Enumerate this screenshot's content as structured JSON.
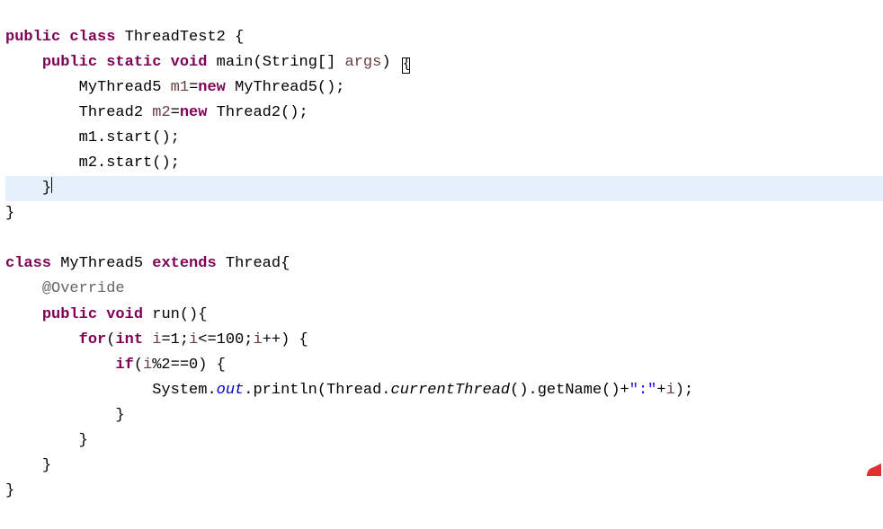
{
  "code": {
    "line1": {
      "public": "public",
      "class": "class",
      "classname": "ThreadTest2",
      "brace": "{"
    },
    "line2": {
      "public": "public",
      "static": "static",
      "void": "void",
      "method": "main",
      "paramtype": "String[]",
      "paramname": "args",
      "close": ")",
      "brace": "{"
    },
    "line3": {
      "type": "MyThread5",
      "varname": "m1",
      "eq": "=",
      "new": "new",
      "ctor": "MyThread5()",
      "semi": ";"
    },
    "line4": {
      "type": "Thread2",
      "varname": "m2",
      "eq": "=",
      "new": "new",
      "ctor": "Thread2()",
      "semi": ";"
    },
    "line5": {
      "text": "m1.start();"
    },
    "line6": {
      "text": "m2.start();"
    },
    "line7": {
      "brace": "}"
    },
    "line8": {
      "brace": "}"
    },
    "line9": {
      "blank": ""
    },
    "line10": {
      "class": "class",
      "classname": "MyThread5",
      "extends": "extends",
      "supername": "Thread",
      "brace": "{"
    },
    "line11": {
      "annotation": "@Override"
    },
    "line12": {
      "public": "public",
      "void": "void",
      "method": "run",
      "parens": "()",
      "brace": "{"
    },
    "line13": {
      "for": "for",
      "open": "(",
      "int": "int",
      "var": "i",
      "init": "=1;",
      "cond_var": "i",
      "cond": "<=100;",
      "inc_var": "i",
      "inc": "++)",
      "brace": " {"
    },
    "line14": {
      "if": "if",
      "open": "(",
      "var": "i",
      "cond": "%2==0)",
      "brace": " {"
    },
    "line15": {
      "sys": "System.",
      "out": "out",
      "println": ".println(Thread.",
      "ct": "currentThread",
      "rest1": "().getName()+",
      "str": "\":\"",
      "rest2": "+",
      "var": "i",
      "rest3": ");"
    },
    "line16": {
      "brace": "}"
    },
    "line17": {
      "brace": "}"
    },
    "line18": {
      "brace": "}"
    },
    "line19": {
      "brace": "}"
    }
  }
}
